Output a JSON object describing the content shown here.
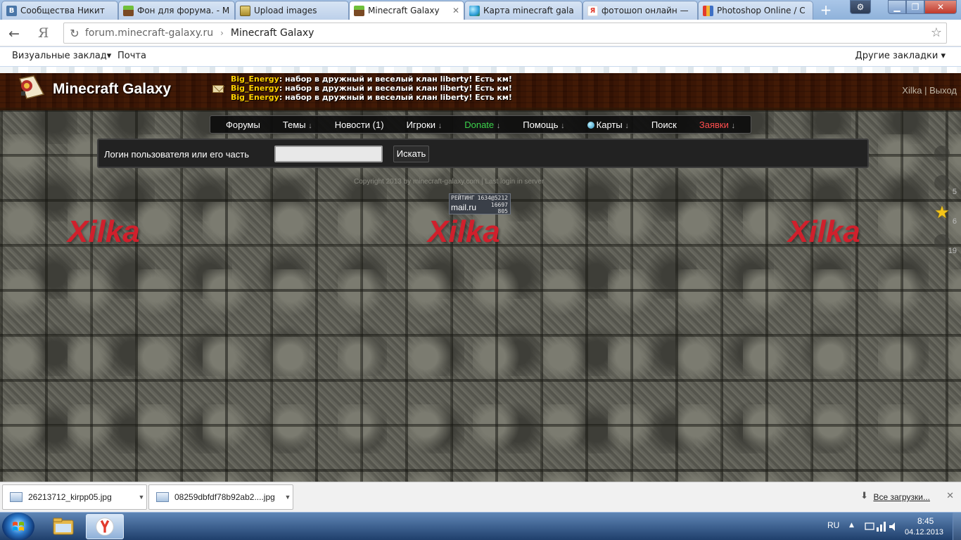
{
  "browser": {
    "tabs": [
      {
        "title": "Сообщества Никит",
        "favicon": "vk-icon",
        "color": "#4a76a8",
        "glyph": "В"
      },
      {
        "title": "Фон для форума. - М",
        "favicon": "minecraft-grass-icon",
        "color": "#6a8f3a",
        "glyph": ""
      },
      {
        "title": "Upload images",
        "favicon": "upload-image-icon",
        "color": "#c9a63a",
        "glyph": ""
      },
      {
        "title": "Minecraft Galaxy",
        "favicon": "minecraft-grass-icon",
        "color": "#6a8f3a",
        "glyph": "",
        "active": true
      },
      {
        "title": "Карта minecraft gala",
        "favicon": "globe-icon",
        "color": "#2a9bd8",
        "glyph": ""
      },
      {
        "title": "фотошоп онлайн —",
        "favicon": "yandex-icon",
        "color": "#e23b2e",
        "glyph": "Я"
      },
      {
        "title": "Photoshop Online / С",
        "favicon": "photoshop-icon",
        "color": "#3d6fc4",
        "glyph": ""
      }
    ],
    "close_glyph": "✕",
    "address": {
      "domain": "forum.minecraft-galaxy.ru",
      "separator": "›",
      "page_title": "Minecraft Galaxy"
    },
    "bookmarks": {
      "visual": "Визуальные заклад▾",
      "mail": "Почта",
      "other": "Другие закладки ▾"
    }
  },
  "site": {
    "title": "Minecraft Galaxy",
    "shoutbox": [
      {
        "author": "Big_Energy",
        "message": ": набор в дружный и веселый клан liberty! Есть км!"
      },
      {
        "author": "Big_Energy",
        "message": ": набор в дружный и веселый клан liberty! Есть км!"
      },
      {
        "author": "Big_Energy",
        "message": ": набор в дружный и веселый клан liberty! Есть км!"
      }
    ],
    "user": {
      "name": "Xilka",
      "separator": " | ",
      "logout": "Выход"
    },
    "nav": [
      {
        "label": "Форумы",
        "arrow": ""
      },
      {
        "label": "Темы",
        "arrow": "↓"
      },
      {
        "label": "Новости (1)",
        "arrow": ""
      },
      {
        "label": "Игроки",
        "arrow": "↓"
      },
      {
        "label": "Donate",
        "arrow": "↓",
        "color": "#3bd34b"
      },
      {
        "label": "Помощь",
        "arrow": "↓"
      },
      {
        "label": "Карты",
        "arrow": "↓",
        "icon": "globe-icon"
      },
      {
        "label": "Поиск",
        "arrow": ""
      },
      {
        "label": "Заявки",
        "arrow": "↓",
        "color": "#ff4d4d"
      }
    ],
    "search": {
      "label": "Логин пользователя или его часть",
      "value": "",
      "button": "Искать"
    },
    "copyright": "Copyright 2013 by minecraft-galaxy.com | Last login in server",
    "counter": {
      "label": "РЕЙТИНГ",
      "total": "1634@5212",
      "brand": "mail.ru",
      "value1": "16697",
      "value2": "805"
    },
    "watermark": "Xilka",
    "side_counts": [
      "",
      "5",
      "6",
      "19"
    ]
  },
  "downloads": {
    "items": [
      "26213712_kirpp05.jpg",
      "08259dbfdf78b92ab2....jpg"
    ],
    "all_label": "Все загрузки...",
    "close": "✕"
  },
  "taskbar": {
    "lang": "RU",
    "time": "8:45",
    "date": "04.12.2013"
  }
}
